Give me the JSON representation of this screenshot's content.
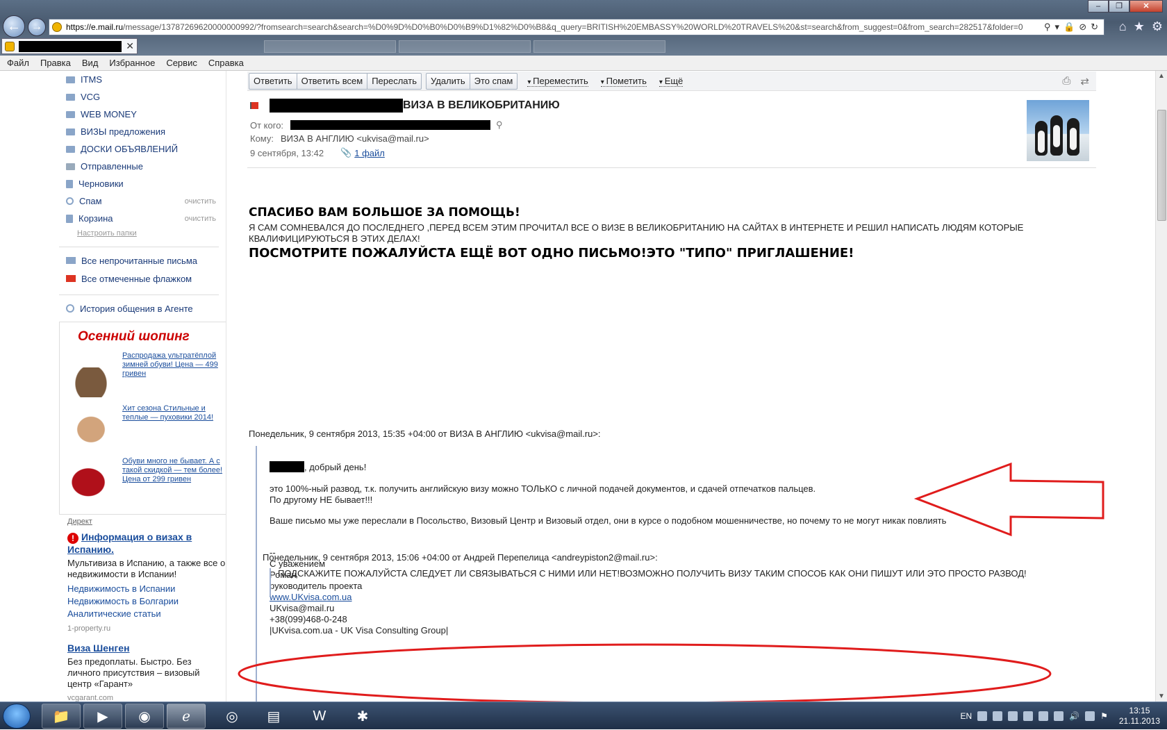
{
  "browser": {
    "url_scheme_host": "https://e.mail.ru",
    "url_rest": "/message/13787269620000000992/?fromsearch=search&search=%D0%9D%D0%B0%D0%B9%D1%82%D0%B8&q_query=BRITISH%20EMBASSY%20WORLD%20TRAVELS%20&st=search&from_suggest=0&from_search=282517&folder=0"
  },
  "menu": [
    "Файл",
    "Правка",
    "Вид",
    "Избранное",
    "Сервис",
    "Справка"
  ],
  "folders": [
    {
      "label": "ITMS"
    },
    {
      "label": "VCG"
    },
    {
      "label": "WEB MONEY"
    },
    {
      "label": "ВИЗЫ предложения"
    },
    {
      "label": "ДОСКИ ОБЪЯВЛЕНИЙ"
    },
    {
      "label": "Отправленные"
    },
    {
      "label": "Черновики"
    },
    {
      "label": "Спам",
      "clear": "очистить"
    },
    {
      "label": "Корзина",
      "clear": "очистить"
    }
  ],
  "folder_setup": "Настроить папки",
  "special": {
    "unread": "Все непрочитанные письма",
    "flagged": "Все отмеченные флажком",
    "agent_history": "История общения в Агенте"
  },
  "promo": {
    "title": "Осенний шопинг",
    "items": [
      "Распродажа ультратёплой зимней обуви! Цена — 499 гривен",
      "Хит сезона Стильные и теплые — пуховики 2014!",
      "Обуви много не бывает. А с такой скидкой — тем более! Цена от 299 гривен"
    ]
  },
  "ads": {
    "direct_label": "Директ",
    "ad1": {
      "title": "Информация о визах в Испанию.",
      "body": "Мультивиза в Испанию, а также все о недвижимости в Испании!",
      "links": [
        "Недвижимость в Испании",
        "Недвижимость в Болгарии",
        "Аналитические статьи"
      ],
      "domain": "1-property.ru"
    },
    "ad2": {
      "title": "Виза Шенген",
      "body": "Без предоплаты. Быстро. Без личного присутствия – визовый центр «Гарант»",
      "domain": "vcgarant.com"
    }
  },
  "toolbar": {
    "reply": "Ответить",
    "reply_all": "Ответить всем",
    "forward": "Переслать",
    "delete": "Удалить",
    "spam": "Это спам",
    "move": "Переместить",
    "mark": "Пометить",
    "more": "Ещё"
  },
  "message": {
    "subject": "ВИЗА В ВЕЛИКОБРИТАНИЮ",
    "from_label": "От кого:",
    "to_label": "Кому:",
    "to_value": "ВИЗА В АНГЛИЮ <ukvisa@mail.ru>",
    "date": "9 сентября, 13:42",
    "attachments": "1 файл"
  },
  "body": {
    "thanks": "СПАСИБО ВАМ БОЛЬШОЕ ЗА ПОМОЩЬ!",
    "doubt": "Я САМ СОМНЕВАЛСЯ ДО ПОСЛЕДНЕГО ,ПЕРЕД ВСЕМ ЭТИМ ПРОЧИТАЛ ВСЕ О ВИЗЕ В ВЕЛИКОБРИТАНИЮ НА САЙТАХ В ИНТЕРНЕТЕ И РЕШИЛ НАПИСАТЬ ЛЮДЯМ КОТОРЫЕ КВАЛИФИЦИРУЮТЬСЯ В ЭТИХ ДЕЛАХ!",
    "see_also": "ПОСМОТРИТЕ ПОЖАЛУЙСТА ЕЩЁ ВОТ ОДНО ПИСЬМО!ЭТО \"ТИПО\" ПРИГЛАШЕНИЕ!",
    "quote1_header": "Понедельник, 9 сентября 2013, 15:35 +04:00 от ВИЗА В АНГЛИЮ <ukvisa@mail.ru>:",
    "greeting": ", добрый день!",
    "line1": "это 100%-ный развод, т.к. получить английскую визу можно ТОЛЬКО с личной подачей документов, и сдачей отпечатков пальцев.",
    "line2": "По другому НЕ бывает!!!",
    "line3": "Ваше письмо мы уже переслали в Посольство, Визовый Центр и Визовый отдел, они в курсе о подобном мошенничестве, но почему то не могут никак повлиять",
    "sig_dash": "--",
    "sig_regards": "С уважением",
    "sig_name": "Роман",
    "sig_role": "руководитель проекта",
    "sig_site": "www.UKvisa.com.ua",
    "sig_email": "UKvisa@mail.ru",
    "sig_phone": "+38(099)468-0-248",
    "sig_company": "|UKvisa.com.ua - UK Visa Consulting Group|",
    "quote2_header": "Понедельник, 9 сентября 2013, 15:06 +04:00 от Андрей Перепелица <andreypiston2@mail.ru>:",
    "quote2_text": "ПОДСКАЖИТЕ ПОЖАЛУЙСТА СЛЕДУЕТ ЛИ СВЯЗЫВАТЬСЯ С НИМИ ИЛИ НЕТ!ВОЗМОЖНО ПОЛУЧИТЬ ВИЗУ ТАКИМ СПОСОБ КАК ОНИ ПИШУТ ИЛИ ЭТО ПРОСТО РАЗВОД!"
  },
  "taskbar": {
    "lang": "EN",
    "time": "13:15",
    "date": "21.11.2013"
  }
}
